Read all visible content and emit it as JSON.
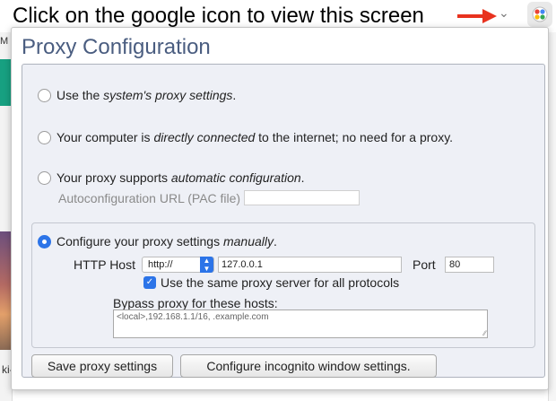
{
  "instruction": "Click on the google icon to view this screen",
  "colors": {
    "arrow": "#e8321e",
    "title": "#4a5d80",
    "accent": "#2c74e8"
  },
  "background": {
    "left_letter": "M",
    "bottom_left_text": "ki-c"
  },
  "popup": {
    "title": "Proxy Configuration",
    "options": {
      "system": {
        "pre": "Use the ",
        "em": "system's proxy settings",
        "post": "."
      },
      "direct": {
        "pre": "Your computer is ",
        "em": "directly connected",
        "post": " to the internet; no need for a proxy."
      },
      "auto": {
        "pre": "Your proxy supports ",
        "em": "automatic configuration",
        "post": "."
      },
      "manual": {
        "pre": "Configure your proxy settings ",
        "em": "manually",
        "post": "."
      }
    },
    "pac_label": "Autoconfiguration URL (PAC file)",
    "pac_value": "",
    "manual": {
      "http_host_label": "HTTP Host",
      "scheme": "http://",
      "host_value": "127.0.0.1",
      "port_label": "Port",
      "port_value": "80",
      "same_proxy_label": "Use the same proxy server for all protocols",
      "same_proxy_checked": true,
      "bypass_label": "Bypass proxy for these hosts:",
      "bypass_value": "<local>,192.168.1.1/16, .example.com"
    },
    "buttons": {
      "save": "Save proxy settings",
      "incognito": "Configure incognito window settings."
    },
    "selected_option": "manual"
  }
}
